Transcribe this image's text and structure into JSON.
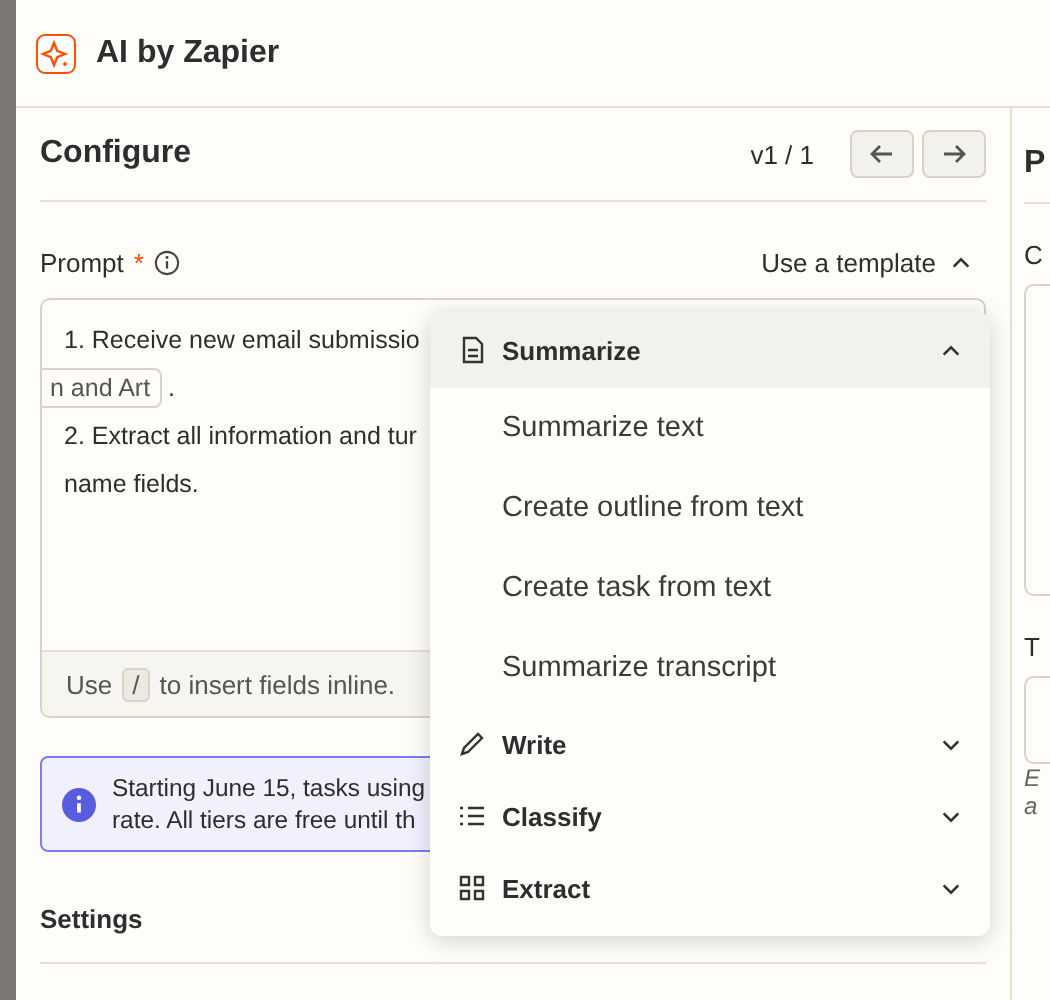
{
  "header": {
    "title": "AI by Zapier"
  },
  "configure": {
    "title": "Configure",
    "version": "v1 / 1"
  },
  "prompt": {
    "label": "Prompt",
    "required": "*",
    "template_button": "Use a template",
    "template_open": true,
    "lines": [
      {
        "text": "1. Receive new email submissio"
      },
      {
        "pill": "n and Art",
        "after": "."
      },
      {
        "text": "2. Extract all information and tur"
      },
      {
        "text": "name fields."
      }
    ],
    "footer": {
      "before": "Use",
      "key": "/",
      "after": "to insert fields inline."
    }
  },
  "template_menu": {
    "groups": [
      {
        "label": "Summarize",
        "expanded": true,
        "items": [
          "Summarize text",
          "Create outline from text",
          "Create task from text",
          "Summarize transcript"
        ]
      },
      {
        "label": "Write",
        "expanded": false
      },
      {
        "label": "Classify",
        "expanded": false
      },
      {
        "label": "Extract",
        "expanded": false
      }
    ]
  },
  "notice": {
    "lines": [
      "Starting June 15, tasks using",
      "rate. All tiers are free until th"
    ]
  },
  "settings": {
    "title": "Settings"
  },
  "side_panel": {
    "heading": "P",
    "label_1": "C",
    "label_2": "T",
    "note_lines": [
      "E",
      "a"
    ]
  }
}
